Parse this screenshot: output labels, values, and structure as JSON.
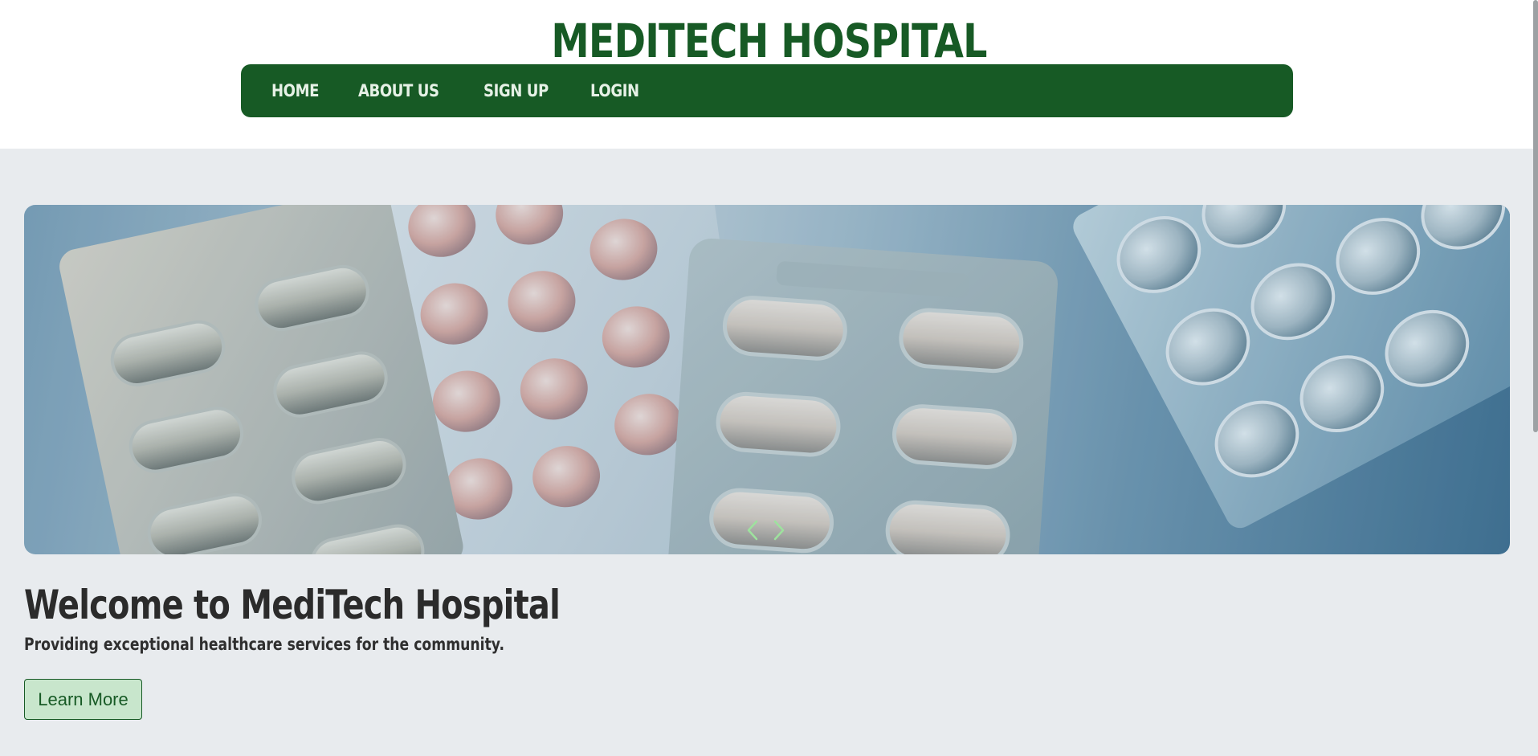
{
  "header": {
    "title": "MEDITECH HOSPITAL"
  },
  "nav": {
    "items": [
      {
        "label": "HOME"
      },
      {
        "label": "ABOUT US"
      },
      {
        "label": "SIGN UP"
      },
      {
        "label": "LOGIN"
      }
    ]
  },
  "hero": {
    "image_subject": "blister packs of pills",
    "controls": {
      "prev_icon": "chevron-left-icon",
      "next_icon": "chevron-right-icon",
      "color": "#9ee29e"
    }
  },
  "content": {
    "heading": "Welcome to MediTech Hospital",
    "subheading": "Providing exceptional healthcare services for the community.",
    "button_label": "Learn More"
  },
  "colors": {
    "brand_green": "#175a25",
    "page_background": "#e8ebee",
    "button_background": "#c8e6cc"
  }
}
